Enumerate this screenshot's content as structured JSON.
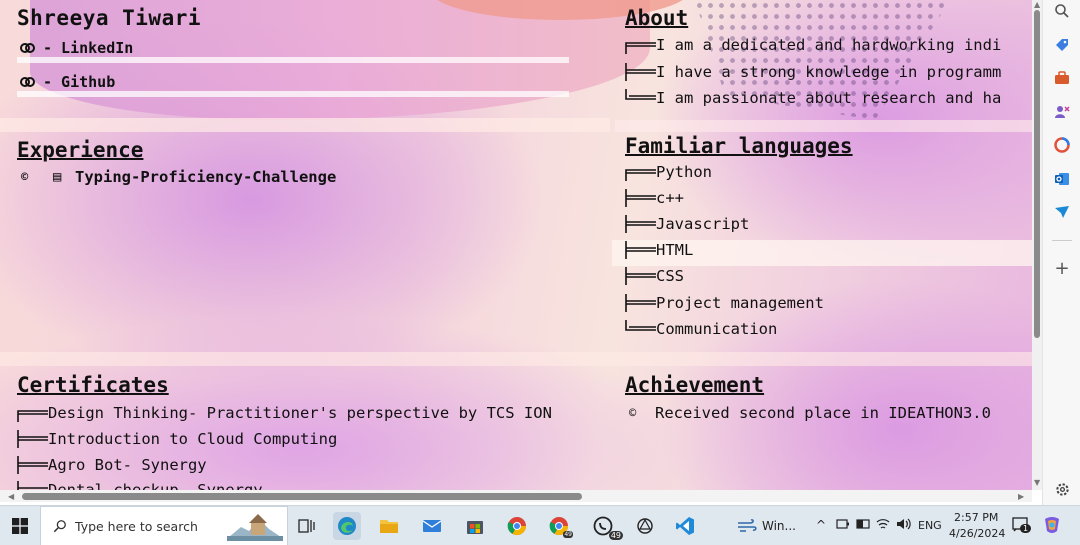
{
  "profile": {
    "name": "Shreeya Tiwari",
    "links": [
      {
        "label": "- LinkedIn"
      },
      {
        "label": "- Github"
      }
    ]
  },
  "about": {
    "heading": "About",
    "lines": [
      "I am a dedicated and hardworking indi",
      "I have a strong knowledge in programm",
      "I am passionate about research and ha"
    ]
  },
  "experience": {
    "heading": "Experience",
    "items": [
      "Typing-Proficiency-Challenge"
    ]
  },
  "languages": {
    "heading": "Familiar languages",
    "items": [
      "Python",
      "c++",
      "Javascript",
      "HTML",
      "CSS",
      "Project management",
      "Communication"
    ]
  },
  "certificates": {
    "heading": "Certificates",
    "items": [
      "Design Thinking- Practitioner's perspective by TCS ION",
      "Introduction to Cloud Computing",
      "Agro Bot- Synergy",
      "Dental checkup- Synergy"
    ]
  },
  "achievement": {
    "heading": "Achievement",
    "items": [
      "Received second place in IDEATHON3.0"
    ]
  },
  "sidebar": {
    "icons": [
      "search-icon",
      "tag-icon",
      "toolbox-icon",
      "people-icon",
      "office-icon",
      "outlook-icon",
      "send-icon",
      "add-icon",
      "settings-icon"
    ]
  },
  "taskbar": {
    "search_placeholder": "Type here to search",
    "chrome_badge": "49",
    "whatsapp_badge": "49",
    "window_label": "Win...",
    "language": "ENG",
    "time": "2:57 PM",
    "date": "4/26/2024",
    "notification_count": "1"
  },
  "colors": {
    "accent_pink": "#d89ad8",
    "taskbar_bg": "#dfe7ef"
  }
}
